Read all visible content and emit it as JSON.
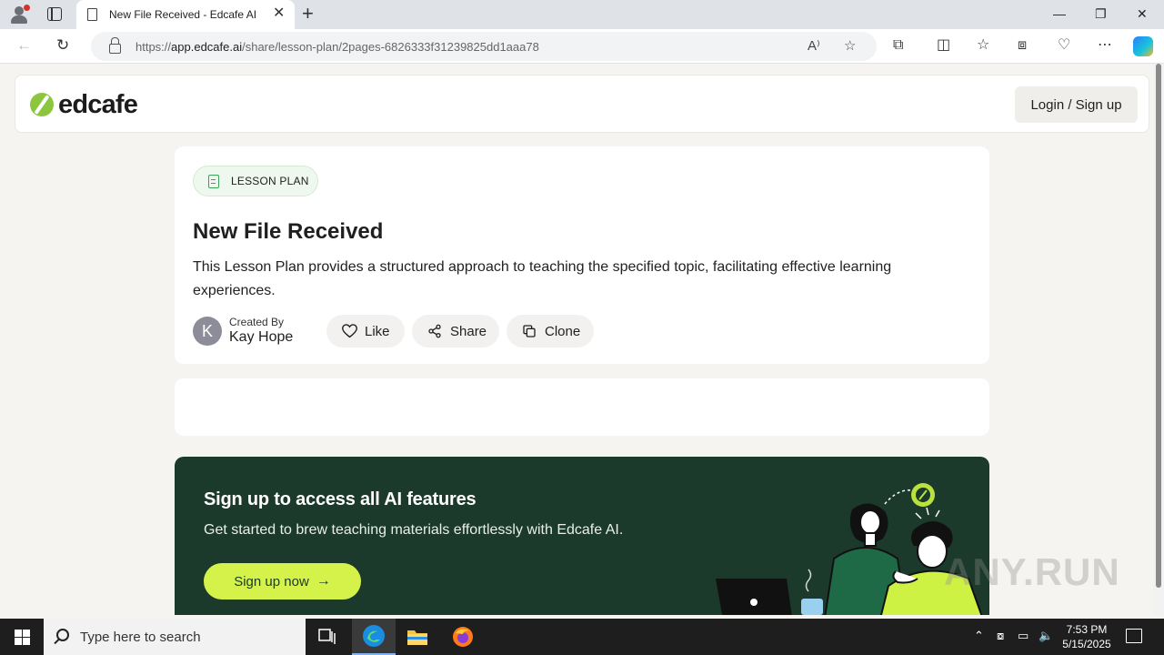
{
  "browser": {
    "tab_title": "New File Received - Edcafe AI",
    "url_scheme": "https://",
    "url_host": "app.edcafe.ai",
    "url_path": "/share/lesson-plan/2pages-6826333f31239825dd1aaa78"
  },
  "site": {
    "logo_text": "edcafe",
    "login_label": "Login / Sign up"
  },
  "lesson": {
    "badge": "LESSON PLAN",
    "title": "New File Received",
    "description": "This Lesson Plan provides a structured approach to teaching the specified topic, facilitating effective learning experiences.",
    "author_initial": "K",
    "created_by_label": "Created By",
    "author_name": "Kay Hope",
    "actions": {
      "like": "Like",
      "share": "Share",
      "clone": "Clone"
    }
  },
  "promo": {
    "title": "Sign up to access all AI features",
    "subtitle": "Get started to brew teaching materials effortlessly with Edcafe AI.",
    "button": "Sign up now",
    "button_arrow": "→"
  },
  "watermark": "ANY.RUN",
  "taskbar": {
    "search_placeholder": "Type here to search",
    "time": "7:53 PM",
    "date": "5/15/2025"
  },
  "colors": {
    "brand_green": "#8cc63f",
    "promo_bg": "#1b3a2c",
    "signup_button": "#d5f24a"
  }
}
